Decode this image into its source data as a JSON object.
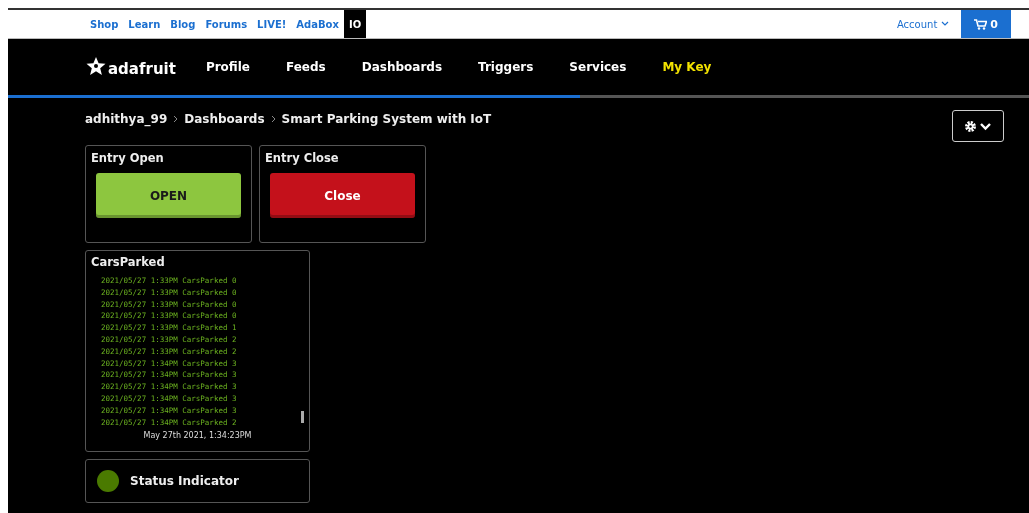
{
  "top_links": [
    {
      "label": "Shop",
      "selected": false
    },
    {
      "label": "Learn",
      "selected": false
    },
    {
      "label": "Blog",
      "selected": false
    },
    {
      "label": "Forums",
      "selected": false
    },
    {
      "label": "LIVE!",
      "selected": false
    },
    {
      "label": "AdaBox",
      "selected": false
    },
    {
      "label": "IO",
      "selected": true
    }
  ],
  "account": "Account",
  "cart_count": "0",
  "logo": "adafruit",
  "nav": [
    {
      "label": "Profile",
      "kind": "link"
    },
    {
      "label": "Feeds",
      "kind": "link"
    },
    {
      "label": "Dashboards",
      "kind": "link"
    },
    {
      "label": "Triggers",
      "kind": "link"
    },
    {
      "label": "Services",
      "kind": "link"
    },
    {
      "label": "My Key",
      "kind": "key"
    }
  ],
  "breadcrumb": [
    "adhithya_99",
    "Dashboards",
    "Smart Parking System with IoT"
  ],
  "blocks": [
    {
      "kind": "button",
      "title": "Entry Open",
      "label": "OPEN",
      "color": "#8dc63f"
    },
    {
      "kind": "button",
      "title": "Entry Close",
      "label": "Close",
      "color": "#c4111b"
    },
    {
      "kind": "stream",
      "title": "CarsParked",
      "rows": [
        {
          "date": "2021/05/27",
          "time": "1:33PM",
          "feed": "CarsParked",
          "value": "0"
        },
        {
          "date": "2021/05/27",
          "time": "1:33PM",
          "feed": "CarsParked",
          "value": "0"
        },
        {
          "date": "2021/05/27",
          "time": "1:33PM",
          "feed": "CarsParked",
          "value": "0"
        },
        {
          "date": "2021/05/27",
          "time": "1:33PM",
          "feed": "CarsParked",
          "value": "0"
        },
        {
          "date": "2021/05/27",
          "time": "1:33PM",
          "feed": "CarsParked",
          "value": "1"
        },
        {
          "date": "2021/05/27",
          "time": "1:33PM",
          "feed": "CarsParked",
          "value": "2"
        },
        {
          "date": "2021/05/27",
          "time": "1:33PM",
          "feed": "CarsParked",
          "value": "2"
        },
        {
          "date": "2021/05/27",
          "time": "1:34PM",
          "feed": "CarsParked",
          "value": "3"
        },
        {
          "date": "2021/05/27",
          "time": "1:34PM",
          "feed": "CarsParked",
          "value": "3"
        },
        {
          "date": "2021/05/27",
          "time": "1:34PM",
          "feed": "CarsParked",
          "value": "3"
        },
        {
          "date": "2021/05/27",
          "time": "1:34PM",
          "feed": "CarsParked",
          "value": "3"
        },
        {
          "date": "2021/05/27",
          "time": "1:34PM",
          "feed": "CarsParked",
          "value": "3"
        },
        {
          "date": "2021/05/27",
          "time": "1:34PM",
          "feed": "CarsParked",
          "value": "2"
        }
      ],
      "footer": "May 27th 2021, 1:34:23PM"
    },
    {
      "kind": "indicator",
      "title": "Status Indicator",
      "color": "#4a7a00"
    }
  ]
}
